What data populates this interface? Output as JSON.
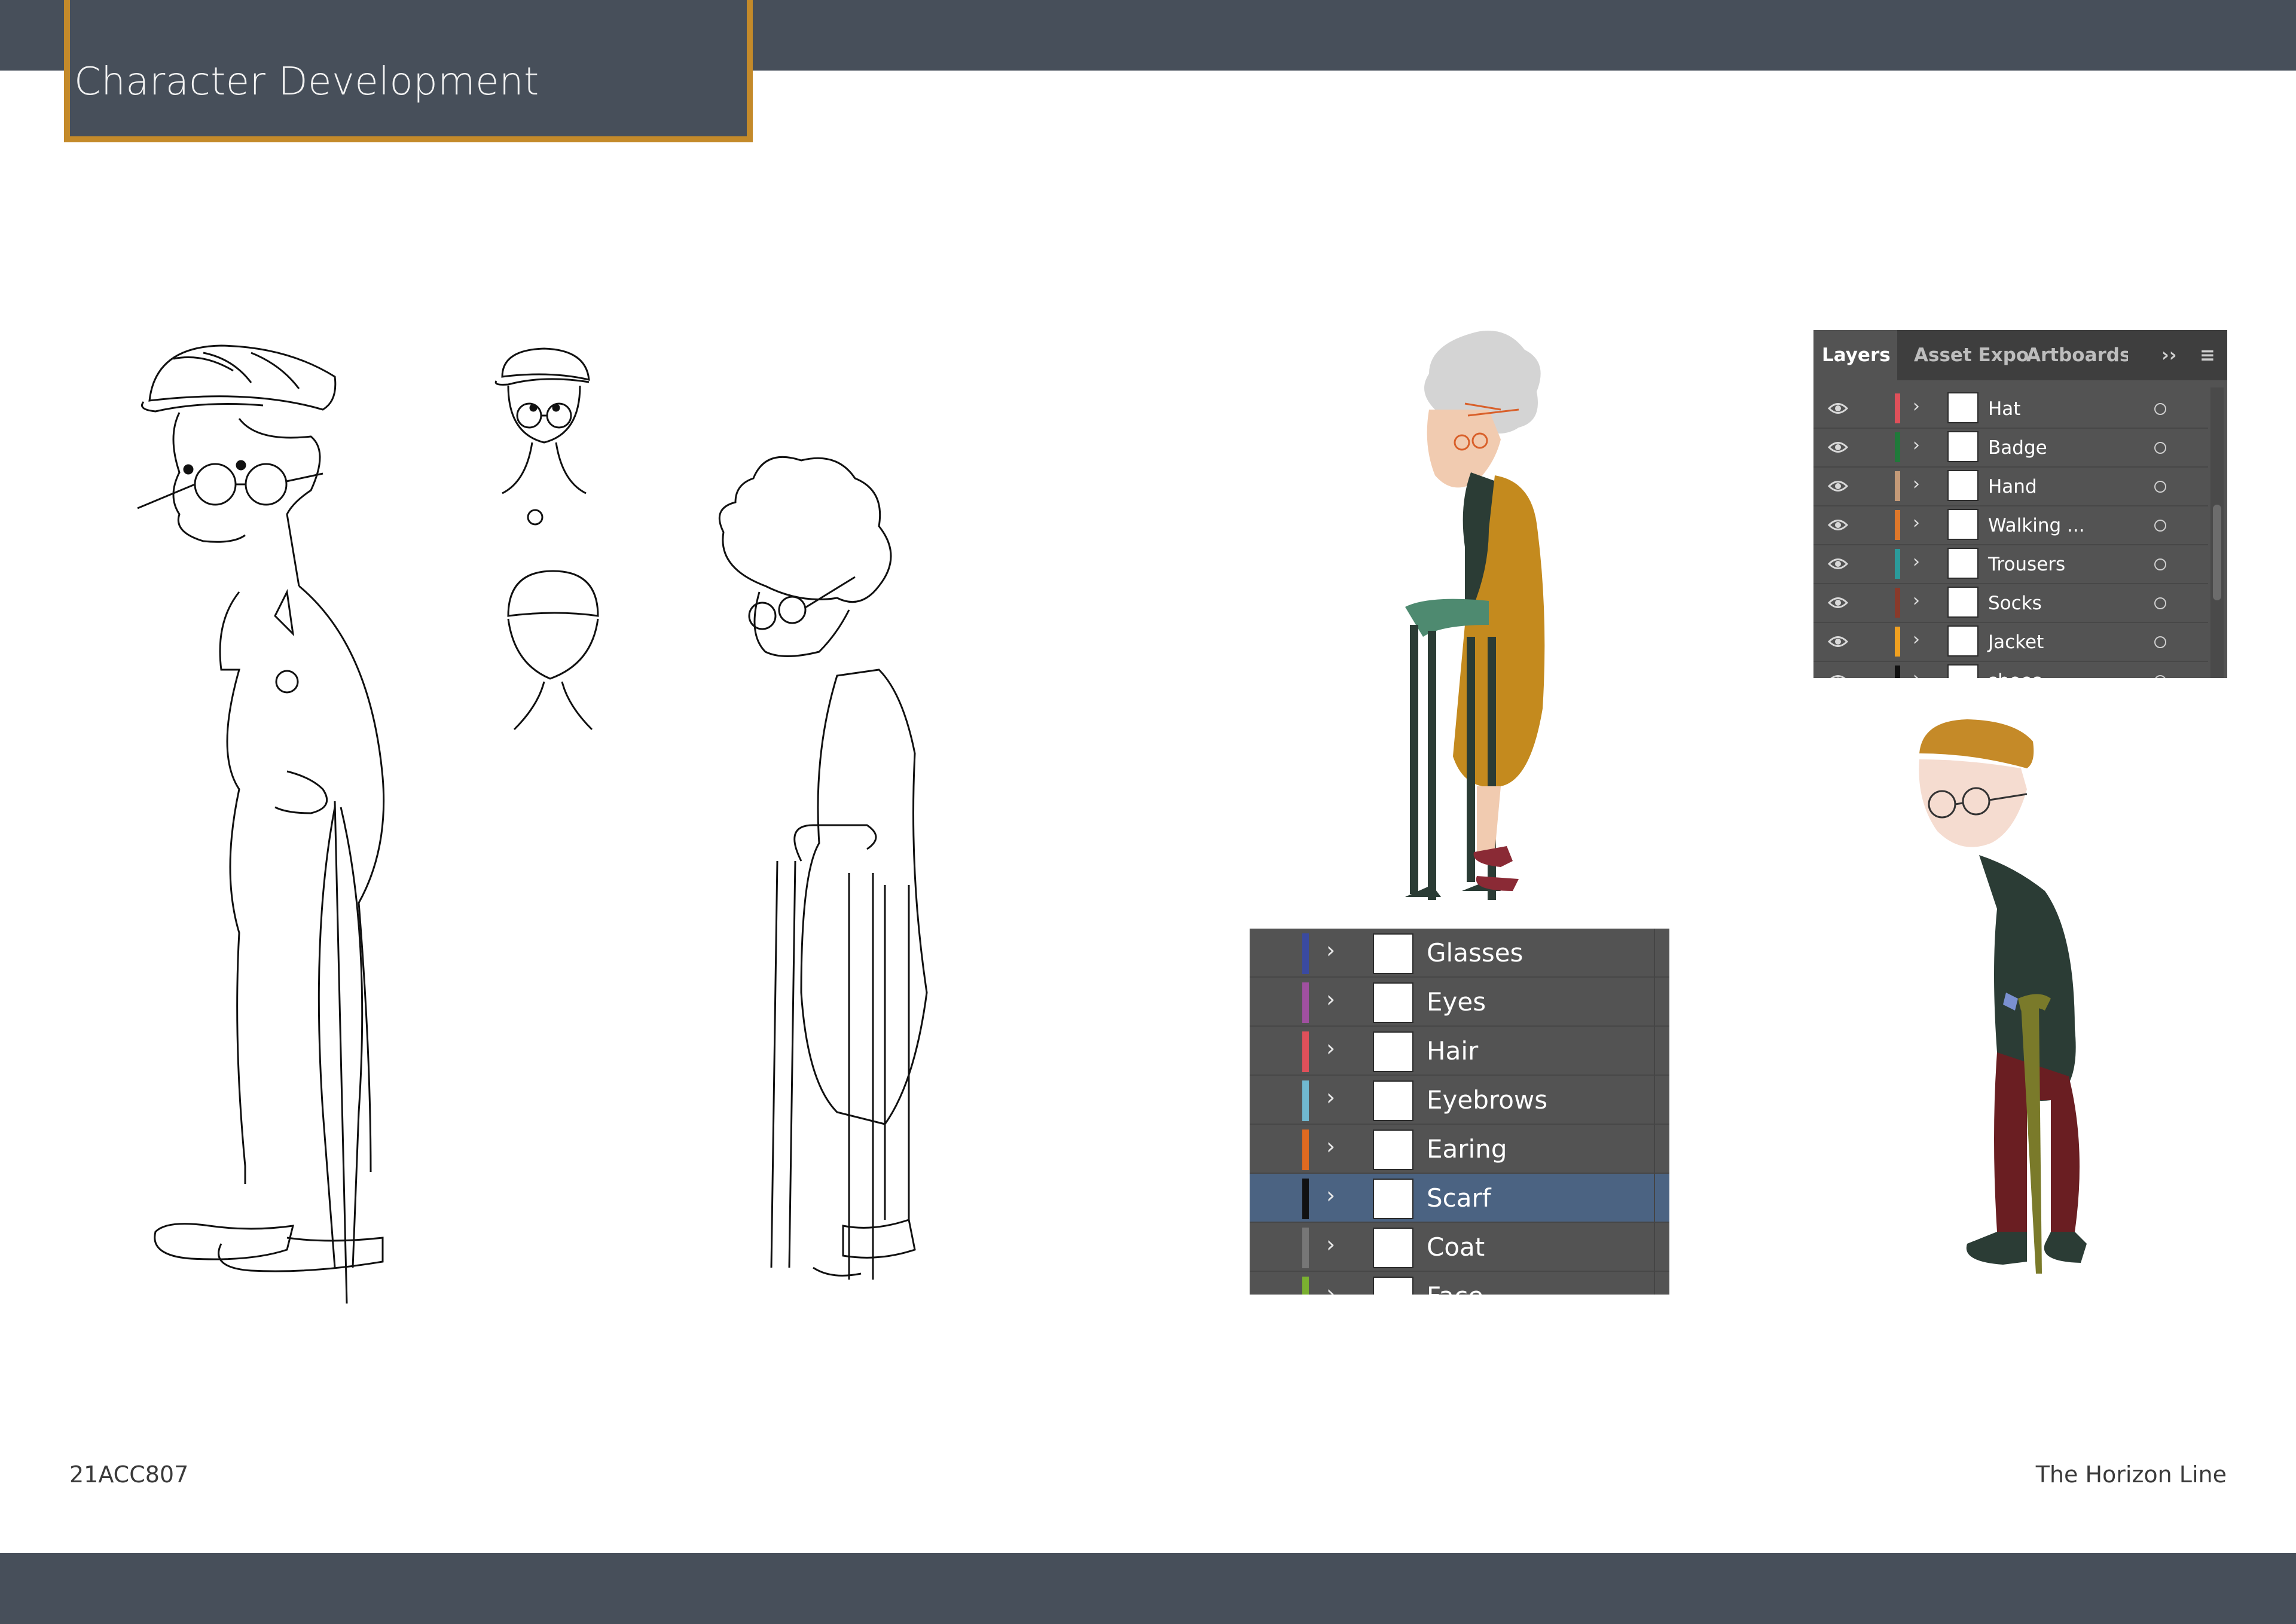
{
  "page": {
    "title": "Character Development",
    "footer_left": "21ACC807",
    "footer_right": "The Horizon Line"
  },
  "colors": {
    "bar": "#474f5a",
    "title_border": "#c48a2a",
    "panel_bg": "#535353",
    "panel_tabs_bg": "#3e3e3e",
    "selected_row": "#4b6382"
  },
  "layers_panel": {
    "tabs": [
      "Layers",
      "Asset Expo",
      "Artboards"
    ],
    "more_icon": "double-chevron-icon",
    "more_label": "›› |",
    "menu_icon": "hamburger-menu-icon",
    "menu_label": "≡",
    "layers": [
      {
        "name": "Hat",
        "color": "#e0505a"
      },
      {
        "name": "Badge",
        "color": "#1f7a3a"
      },
      {
        "name": "Hand",
        "color": "#c49a78"
      },
      {
        "name": "Walking ...",
        "color": "#e0782a"
      },
      {
        "name": "Trousers",
        "color": "#2a9a9a"
      },
      {
        "name": "Socks",
        "color": "#8a3a2a"
      },
      {
        "name": "Jacket",
        "color": "#f0a020"
      },
      {
        "name": "shoes",
        "color": "#111111"
      }
    ]
  },
  "layers_panel_2": {
    "layers": [
      {
        "name": "Glasses",
        "color": "#3a4aa0",
        "selected": false
      },
      {
        "name": "Eyes",
        "color": "#a050a0",
        "selected": false
      },
      {
        "name": "Hair",
        "color": "#e0505a",
        "selected": false
      },
      {
        "name": "Eyebrows",
        "color": "#70b8d0",
        "selected": false
      },
      {
        "name": "Earing",
        "color": "#e06a20",
        "selected": false
      },
      {
        "name": "Scarf",
        "color": "#111111",
        "selected": true
      },
      {
        "name": "Coat",
        "color": "#777777",
        "selected": false
      },
      {
        "name": "Face",
        "color": "#7ab030",
        "selected": false
      }
    ]
  }
}
